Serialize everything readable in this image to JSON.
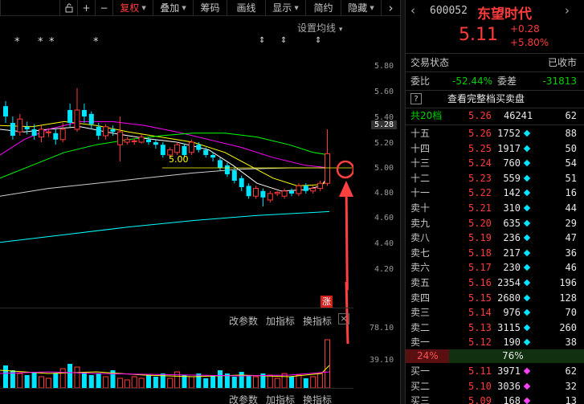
{
  "toolbar": {
    "buttons": [
      {
        "label": "",
        "icon": "lock-icon"
      },
      {
        "label": "+",
        "icon": "plus-icon"
      },
      {
        "label": "−",
        "icon": "minus-icon"
      },
      {
        "label": "复权",
        "caret": true,
        "active": true
      },
      {
        "label": "叠加",
        "caret": true
      },
      {
        "label": "筹码"
      },
      {
        "label": "画线"
      },
      {
        "label": "显示",
        "caret": true
      },
      {
        "label": "简约"
      },
      {
        "label": "隐藏",
        "caret": true
      }
    ],
    "chevron_right": "›"
  },
  "chart": {
    "settings_label": "设置均线",
    "settings_caret": "▾",
    "price_axis": [
      "5.80",
      "5.60",
      "5.40",
      "5.20",
      "5.00",
      "4.80",
      "4.60",
      "4.40",
      "4.20"
    ],
    "current_price_tag": "5.28",
    "ma_annotation": "5.00",
    "limit_up_badge": "涨",
    "event_markers": [
      "*",
      "*",
      "*",
      "*",
      "⇕",
      "⇕",
      "⇕"
    ],
    "indicator_buttons": {
      "params": "改参数",
      "add": "加指标",
      "swap": "换指标",
      "close": "×"
    },
    "volume_axis": [
      "78.10",
      "39.10"
    ],
    "bottom_indicator_buttons": {
      "params": "改参数",
      "add": "加指标",
      "swap": "换指标"
    }
  },
  "panel": {
    "code": "600052",
    "name": "东望时代",
    "price": "5.11",
    "change": "+0.28",
    "change_pct": "+5.80%",
    "status_label": "交易状态",
    "status_value": "已收市",
    "weibi_label": "委比",
    "weibi_value": "-52.44%",
    "weicha_label": "委差",
    "weicha_value": "-31813",
    "full_book_icon": "?",
    "full_book_label": "查看完整档买卖盘",
    "total_label": "共20档",
    "total_price": "5.26",
    "total_volume": "46241",
    "total_count": "62",
    "asks": [
      {
        "label": "十五",
        "price": "5.26",
        "volume": "1752",
        "marker": "cyan",
        "count": "88"
      },
      {
        "label": "十四",
        "price": "5.25",
        "volume": "1917",
        "marker": "cyan",
        "count": "50"
      },
      {
        "label": "十三",
        "price": "5.24",
        "volume": "760",
        "marker": "cyan",
        "count": "54"
      },
      {
        "label": "十二",
        "price": "5.23",
        "volume": "559",
        "marker": "cyan",
        "count": "51"
      },
      {
        "label": "十一",
        "price": "5.22",
        "volume": "142",
        "marker": "cyan",
        "count": "16"
      },
      {
        "label": "卖十",
        "price": "5.21",
        "volume": "310",
        "marker": "cyan",
        "count": "44"
      },
      {
        "label": "卖九",
        "price": "5.20",
        "volume": "635",
        "marker": "cyan",
        "count": "29"
      },
      {
        "label": "卖八",
        "price": "5.19",
        "volume": "236",
        "marker": "cyan",
        "count": "47"
      },
      {
        "label": "卖七",
        "price": "5.18",
        "volume": "217",
        "marker": "cyan",
        "count": "36"
      },
      {
        "label": "卖六",
        "price": "5.17",
        "volume": "230",
        "marker": "cyan",
        "count": "46"
      },
      {
        "label": "卖五",
        "price": "5.16",
        "volume": "2354",
        "marker": "cyan",
        "count": "196"
      },
      {
        "label": "卖四",
        "price": "5.15",
        "volume": "2680",
        "marker": "cyan",
        "count": "128"
      },
      {
        "label": "卖三",
        "price": "5.14",
        "volume": "976",
        "marker": "cyan",
        "count": "70"
      },
      {
        "label": "卖二",
        "price": "5.13",
        "volume": "3115",
        "marker": "cyan",
        "count": "260"
      },
      {
        "label": "卖一",
        "price": "5.12",
        "volume": "190",
        "marker": "cyan",
        "count": "38"
      }
    ],
    "ratio_sell": "24%",
    "ratio_buy": "76%",
    "ratio_sell_fraction": 0.24,
    "bids": [
      {
        "label": "买一",
        "price": "5.11",
        "volume": "3971",
        "marker": "magenta",
        "count": "62"
      },
      {
        "label": "买二",
        "price": "5.10",
        "volume": "3036",
        "marker": "magenta",
        "count": "32"
      },
      {
        "label": "买三",
        "price": "5.09",
        "volume": "168",
        "marker": "magenta",
        "count": "13"
      }
    ]
  },
  "colors": {
    "up": "#ff3b3b",
    "down": "#00e5ff",
    "ma5": "#ffffff",
    "ma10": "#ffff00",
    "ma20": "#ff00ff",
    "ma30": "#00ff00",
    "ma60": "#cccccc",
    "ma120": "#00ffff",
    "arrow": "#ff4040"
  }
}
